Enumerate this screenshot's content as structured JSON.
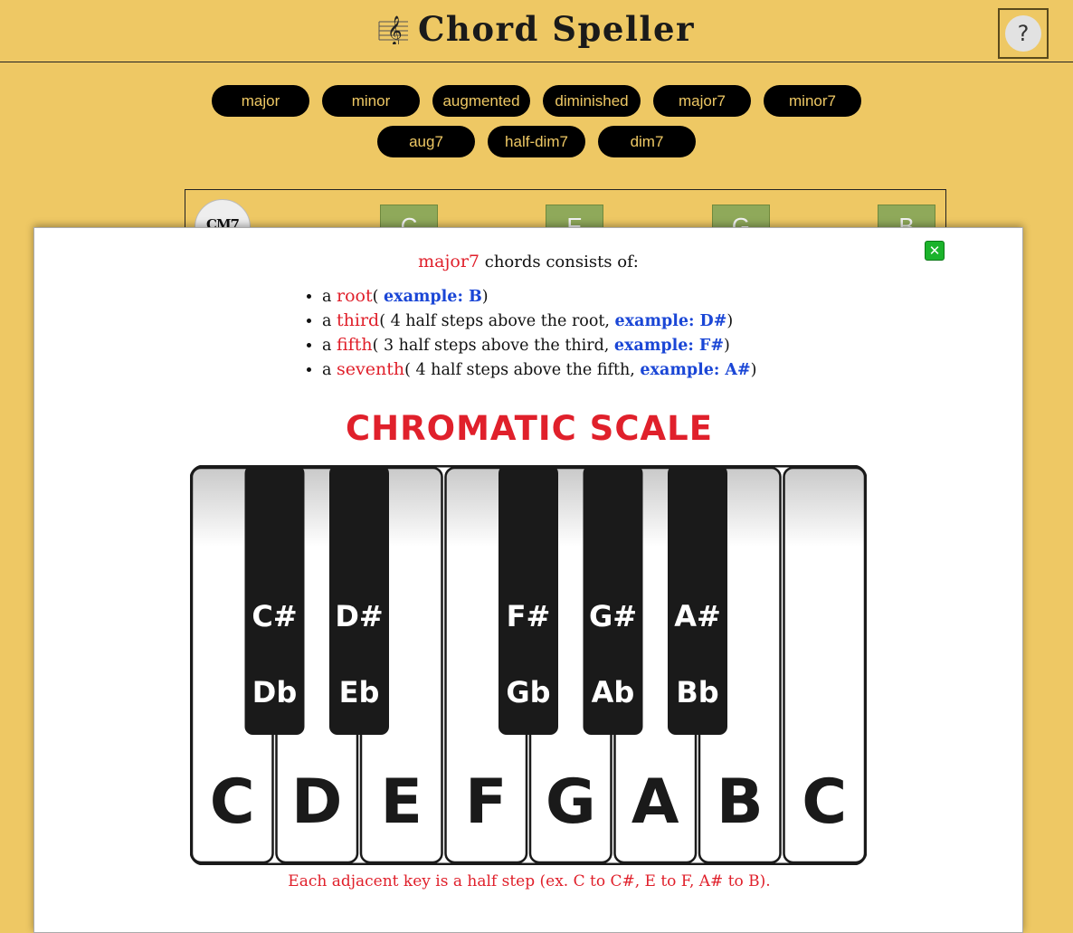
{
  "app": {
    "title": "Chord Speller",
    "help_label": "?"
  },
  "chord_types_row1": [
    "major",
    "minor",
    "augmented",
    "diminished",
    "major7",
    "minor7"
  ],
  "chord_types_row2": [
    "aug7",
    "half-dim7",
    "dim7"
  ],
  "current_chord": {
    "symbol": "CM7",
    "notes": [
      "C",
      "E",
      "G",
      "B"
    ]
  },
  "modal": {
    "close_label": "✕",
    "chord_type": "major7",
    "intro_suffix": " chords consists of:",
    "parts": [
      {
        "prefix": "a ",
        "term": "root",
        "desc": "( ",
        "example": "example: B",
        "suffix": ")"
      },
      {
        "prefix": "a ",
        "term": "third",
        "desc": "( 4 half steps above the root, ",
        "example": "example: D#",
        "suffix": ")"
      },
      {
        "prefix": "a ",
        "term": "fifth",
        "desc": "( 3 half steps above the third, ",
        "example": "example: F#",
        "suffix": ")"
      },
      {
        "prefix": "a ",
        "term": "seventh",
        "desc": "( 4 half steps above the fifth, ",
        "example": "example: A#",
        "suffix": ")"
      }
    ],
    "scale_title": "CHROMATIC SCALE",
    "white_keys": [
      "C",
      "D",
      "E",
      "F",
      "G",
      "A",
      "B",
      "C"
    ],
    "black_keys": [
      {
        "sharp": "C#",
        "flat": "Db"
      },
      {
        "sharp": "D#",
        "flat": "Eb"
      },
      {
        "sharp": "F#",
        "flat": "Gb"
      },
      {
        "sharp": "G#",
        "flat": "Ab"
      },
      {
        "sharp": "A#",
        "flat": "Bb"
      }
    ],
    "footnote": "Each adjacent key is a half step (ex. C to C#, E to F, A# to B)."
  },
  "colors": {
    "background": "#eec864",
    "button_bg": "#000000",
    "button_text": "#eec864",
    "note_box": "#8fa95a",
    "term_red": "#e0202b",
    "example_blue": "#1a46d6",
    "close_green": "#1bb32b"
  }
}
